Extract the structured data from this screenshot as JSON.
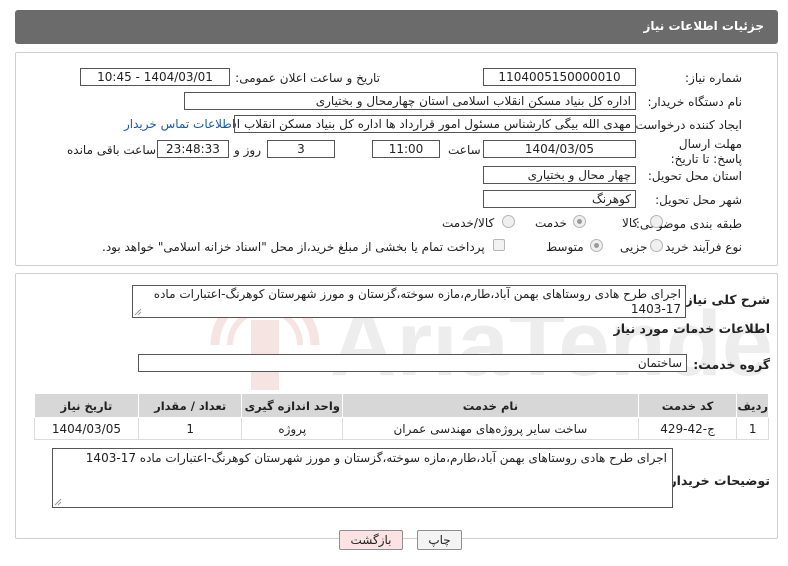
{
  "header": {
    "title": "جزئیات اطلاعات نیاز"
  },
  "fields": {
    "need_number_label": "شماره نیاز:",
    "need_number": "1104005150000010",
    "announce_label": "تاریخ و ساعت اعلان عمومی:",
    "announce_value": "1404/03/01 - 10:45",
    "buyer_org_label": "نام دستگاه خریدار:",
    "buyer_org": "اداره کل بنیاد مسکن انقلاب اسلامی استان چهارمحال و بختیاری",
    "creator_label": "ایجاد کننده درخواست:",
    "creator": "مهدی الله بیگی کارشناس مسئول امور قرارداد ها اداره کل بنیاد مسکن انقلاب اس",
    "contact_link": "اطلاعات تماس خریدار",
    "deadline_label": "مهلت ارسال پاسخ: تا تاریخ:",
    "deadline_date": "1404/03/05",
    "time_label": "ساعت",
    "deadline_time": "11:00",
    "days_value": "3",
    "days_label": "روز و",
    "remaining_time": "23:48:33",
    "remaining_label": "ساعت باقی مانده",
    "province_label": "استان محل تحویل:",
    "province": "چهار محال و بختیاری",
    "city_label": "شهر محل تحویل:",
    "city": "کوهرنگ",
    "category_label": "طبقه بندی موضوعی:",
    "category_options": [
      "کالا",
      "خدمت",
      "کالا/خدمت"
    ],
    "process_label": "نوع فرآیند خرید :",
    "process_options": [
      "جزیی",
      "متوسط"
    ],
    "payment_note": "پرداخت تمام یا بخشی از مبلغ خرید،از محل \"اسناد خزانه اسلامی\" خواهد بود."
  },
  "summary": {
    "label": "شرح کلی نیاز:",
    "text": "اجرای طرح هادی روستاهای بهمن آباد،طارم،مازه سوخته،گزستان و مورز شهرستان کوهرنگ-اعتبارات ماده 17-1403"
  },
  "services": {
    "title": "اطلاعات خدمات مورد نیاز",
    "group_label": "گروه خدمت:",
    "group_value": "ساختمان",
    "columns": [
      "ردیف",
      "کد خدمت",
      "نام خدمت",
      "واحد اندازه گیری",
      "تعداد / مقدار",
      "تاریخ نیاز"
    ],
    "rows": [
      {
        "row": "1",
        "code": "ج-42-429",
        "name": "ساخت سایر پروژه‌های مهندسی عمران",
        "unit": "پروژه",
        "qty": "1",
        "date": "1404/03/05"
      }
    ]
  },
  "buyer_notes": {
    "label": "توضیحات خریدار:",
    "text": "اجرای طرح هادی روستاهای بهمن آباد،طارم،مازه سوخته،گزستان و مورز شهرستان کوهرنگ-اعتبارات ماده 17-1403"
  },
  "buttons": {
    "print": "چاپ",
    "back": "بازگشت"
  },
  "watermark_text": "AriaTender.neT",
  "colors": {
    "header_bg": "#6b6b6b",
    "link": "#1a5aa8",
    "back_button_bg": "#fbe3e4",
    "table_header_bg": "#d7d7d7"
  }
}
